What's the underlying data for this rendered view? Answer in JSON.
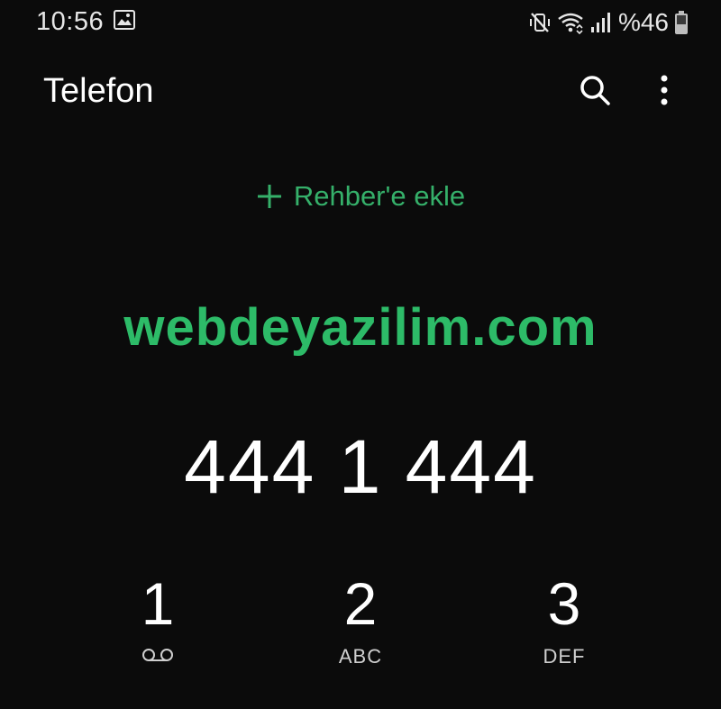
{
  "status_bar": {
    "time": "10:56",
    "battery": "%46",
    "icons": [
      "gallery-icon",
      "mute-vibrate-icon",
      "wifi-icon",
      "signal-icon",
      "battery-icon"
    ]
  },
  "app_bar": {
    "title": "Telefon",
    "icons": [
      "search-icon",
      "more-vert-icon"
    ]
  },
  "add_contact": {
    "label": "Rehber'e ekle",
    "icon": "plus-icon"
  },
  "watermark": "webdeyazilim.com",
  "dialed_number": "444 1 444",
  "keypad": [
    {
      "digit": "1",
      "sub_icon": "voicemail-icon"
    },
    {
      "digit": "2",
      "letters": "ABC"
    },
    {
      "digit": "3",
      "letters": "DEF"
    }
  ],
  "colors": {
    "background": "#0b0b0b",
    "accent": "#35b06a",
    "watermark": "#2dbb68",
    "text": "#ffffff"
  }
}
